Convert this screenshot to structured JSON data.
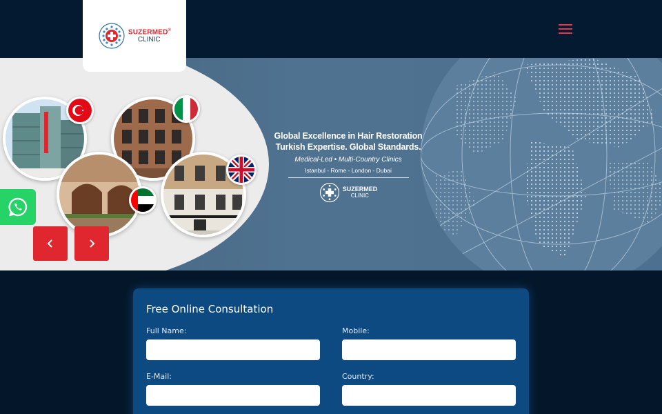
{
  "brand": {
    "name": "SUZERMED",
    "registered_mark": "®",
    "sub": "CLINIC",
    "colors": {
      "red": "#e0262f",
      "navy": "#1f3a5c",
      "whatsapp": "#25d366"
    }
  },
  "header": {
    "menu_icon": "hamburger-menu-icon"
  },
  "hero": {
    "headline_line1": "Global Excellence in Hair Restoration",
    "headline_line2": "Turkish Expertise. Global Standards.",
    "tagline": "Medical-Led  •  Multi-Country Clinics",
    "cities": "Istanbul - Rome - London - Dubai",
    "logo_name": "SUZERMED",
    "logo_sub": "CLINIC",
    "flags": [
      "Turkey",
      "Italy",
      "United Kingdom",
      "United Arab Emirates"
    ]
  },
  "controls": {
    "whatsapp_icon": "whatsapp-icon",
    "prev_icon": "chevron-left-icon",
    "next_icon": "chevron-right-icon"
  },
  "form": {
    "title": "Free Online Consultation",
    "fields": {
      "full_name": {
        "label": "Full Name:",
        "value": ""
      },
      "mobile": {
        "label": "Mobile:",
        "value": ""
      },
      "email": {
        "label": "E-Mail:",
        "value": ""
      },
      "country": {
        "label": "Country:",
        "value": ""
      }
    }
  }
}
